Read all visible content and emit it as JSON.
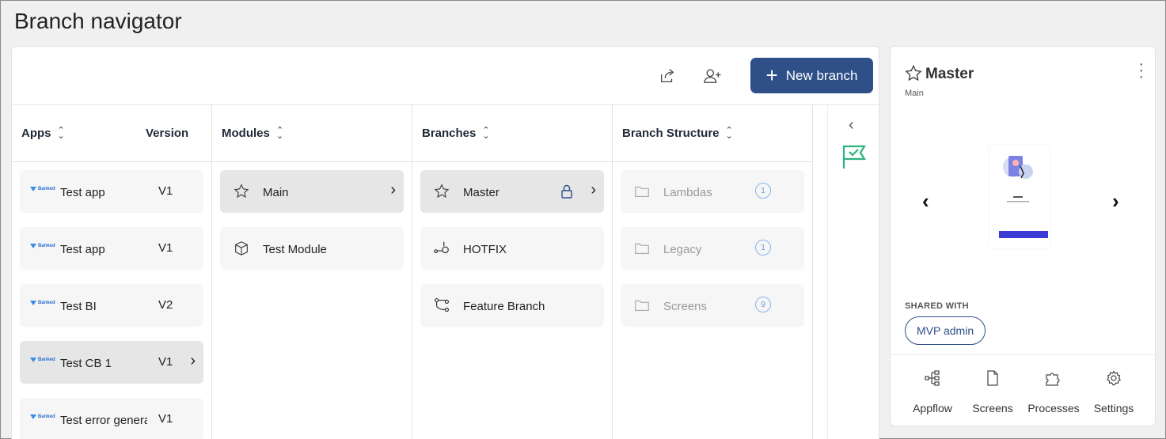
{
  "page": {
    "title": "Branch navigator"
  },
  "toolbar": {
    "new_branch_label": "New branch"
  },
  "columns": {
    "apps": {
      "header": "Apps",
      "version_header": "Version",
      "items": [
        {
          "name": "Test app",
          "version": "V1"
        },
        {
          "name": "Test app",
          "version": "V1"
        },
        {
          "name": "Test BI",
          "version": "V2"
        },
        {
          "name": "Test CB 1",
          "version": "V1"
        },
        {
          "name": "Test error generator",
          "version": "V1"
        }
      ],
      "logo_text": "Banked"
    },
    "modules": {
      "header": "Modules",
      "items": [
        {
          "name": "Main"
        },
        {
          "name": "Test Module"
        }
      ]
    },
    "branches": {
      "header": "Branches",
      "items": [
        {
          "name": "Master"
        },
        {
          "name": "HOTFIX"
        },
        {
          "name": "Feature Branch"
        }
      ]
    },
    "structure": {
      "header": "Branch Structure",
      "items": [
        {
          "name": "Lambdas",
          "count": "1"
        },
        {
          "name": "Legacy",
          "count": "1"
        },
        {
          "name": "Screens",
          "count": "9"
        }
      ]
    }
  },
  "detail": {
    "title": "Master",
    "subtitle": "Main",
    "shared_with_label": "SHARED WITH",
    "shared_with": "MVP admin",
    "nav": [
      "Appflow",
      "Screens",
      "Processes",
      "Settings"
    ]
  },
  "colors": {
    "primary": "#2e4f88",
    "accent_green": "#2bb380",
    "badge_blue": "#8ab6e8"
  }
}
